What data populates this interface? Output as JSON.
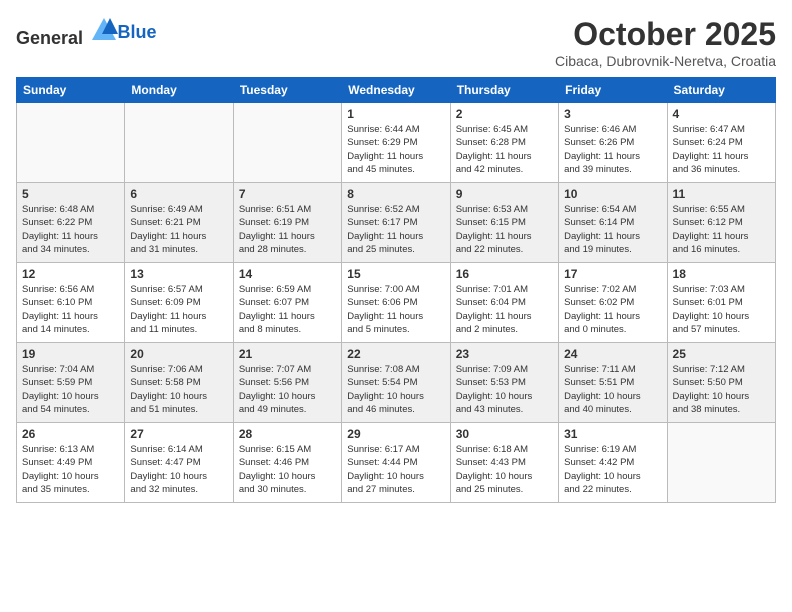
{
  "header": {
    "logo_general": "General",
    "logo_blue": "Blue",
    "month_title": "October 2025",
    "location": "Cibaca, Dubrovnik-Neretva, Croatia"
  },
  "days_of_week": [
    "Sunday",
    "Monday",
    "Tuesday",
    "Wednesday",
    "Thursday",
    "Friday",
    "Saturday"
  ],
  "weeks": [
    {
      "days": [
        {
          "number": "",
          "info": ""
        },
        {
          "number": "",
          "info": ""
        },
        {
          "number": "",
          "info": ""
        },
        {
          "number": "1",
          "info": "Sunrise: 6:44 AM\nSunset: 6:29 PM\nDaylight: 11 hours\nand 45 minutes."
        },
        {
          "number": "2",
          "info": "Sunrise: 6:45 AM\nSunset: 6:28 PM\nDaylight: 11 hours\nand 42 minutes."
        },
        {
          "number": "3",
          "info": "Sunrise: 6:46 AM\nSunset: 6:26 PM\nDaylight: 11 hours\nand 39 minutes."
        },
        {
          "number": "4",
          "info": "Sunrise: 6:47 AM\nSunset: 6:24 PM\nDaylight: 11 hours\nand 36 minutes."
        }
      ]
    },
    {
      "days": [
        {
          "number": "5",
          "info": "Sunrise: 6:48 AM\nSunset: 6:22 PM\nDaylight: 11 hours\nand 34 minutes."
        },
        {
          "number": "6",
          "info": "Sunrise: 6:49 AM\nSunset: 6:21 PM\nDaylight: 11 hours\nand 31 minutes."
        },
        {
          "number": "7",
          "info": "Sunrise: 6:51 AM\nSunset: 6:19 PM\nDaylight: 11 hours\nand 28 minutes."
        },
        {
          "number": "8",
          "info": "Sunrise: 6:52 AM\nSunset: 6:17 PM\nDaylight: 11 hours\nand 25 minutes."
        },
        {
          "number": "9",
          "info": "Sunrise: 6:53 AM\nSunset: 6:15 PM\nDaylight: 11 hours\nand 22 minutes."
        },
        {
          "number": "10",
          "info": "Sunrise: 6:54 AM\nSunset: 6:14 PM\nDaylight: 11 hours\nand 19 minutes."
        },
        {
          "number": "11",
          "info": "Sunrise: 6:55 AM\nSunset: 6:12 PM\nDaylight: 11 hours\nand 16 minutes."
        }
      ]
    },
    {
      "days": [
        {
          "number": "12",
          "info": "Sunrise: 6:56 AM\nSunset: 6:10 PM\nDaylight: 11 hours\nand 14 minutes."
        },
        {
          "number": "13",
          "info": "Sunrise: 6:57 AM\nSunset: 6:09 PM\nDaylight: 11 hours\nand 11 minutes."
        },
        {
          "number": "14",
          "info": "Sunrise: 6:59 AM\nSunset: 6:07 PM\nDaylight: 11 hours\nand 8 minutes."
        },
        {
          "number": "15",
          "info": "Sunrise: 7:00 AM\nSunset: 6:06 PM\nDaylight: 11 hours\nand 5 minutes."
        },
        {
          "number": "16",
          "info": "Sunrise: 7:01 AM\nSunset: 6:04 PM\nDaylight: 11 hours\nand 2 minutes."
        },
        {
          "number": "17",
          "info": "Sunrise: 7:02 AM\nSunset: 6:02 PM\nDaylight: 11 hours\nand 0 minutes."
        },
        {
          "number": "18",
          "info": "Sunrise: 7:03 AM\nSunset: 6:01 PM\nDaylight: 10 hours\nand 57 minutes."
        }
      ]
    },
    {
      "days": [
        {
          "number": "19",
          "info": "Sunrise: 7:04 AM\nSunset: 5:59 PM\nDaylight: 10 hours\nand 54 minutes."
        },
        {
          "number": "20",
          "info": "Sunrise: 7:06 AM\nSunset: 5:58 PM\nDaylight: 10 hours\nand 51 minutes."
        },
        {
          "number": "21",
          "info": "Sunrise: 7:07 AM\nSunset: 5:56 PM\nDaylight: 10 hours\nand 49 minutes."
        },
        {
          "number": "22",
          "info": "Sunrise: 7:08 AM\nSunset: 5:54 PM\nDaylight: 10 hours\nand 46 minutes."
        },
        {
          "number": "23",
          "info": "Sunrise: 7:09 AM\nSunset: 5:53 PM\nDaylight: 10 hours\nand 43 minutes."
        },
        {
          "number": "24",
          "info": "Sunrise: 7:11 AM\nSunset: 5:51 PM\nDaylight: 10 hours\nand 40 minutes."
        },
        {
          "number": "25",
          "info": "Sunrise: 7:12 AM\nSunset: 5:50 PM\nDaylight: 10 hours\nand 38 minutes."
        }
      ]
    },
    {
      "days": [
        {
          "number": "26",
          "info": "Sunrise: 6:13 AM\nSunset: 4:49 PM\nDaylight: 10 hours\nand 35 minutes."
        },
        {
          "number": "27",
          "info": "Sunrise: 6:14 AM\nSunset: 4:47 PM\nDaylight: 10 hours\nand 32 minutes."
        },
        {
          "number": "28",
          "info": "Sunrise: 6:15 AM\nSunset: 4:46 PM\nDaylight: 10 hours\nand 30 minutes."
        },
        {
          "number": "29",
          "info": "Sunrise: 6:17 AM\nSunset: 4:44 PM\nDaylight: 10 hours\nand 27 minutes."
        },
        {
          "number": "30",
          "info": "Sunrise: 6:18 AM\nSunset: 4:43 PM\nDaylight: 10 hours\nand 25 minutes."
        },
        {
          "number": "31",
          "info": "Sunrise: 6:19 AM\nSunset: 4:42 PM\nDaylight: 10 hours\nand 22 minutes."
        },
        {
          "number": "",
          "info": ""
        }
      ]
    }
  ]
}
